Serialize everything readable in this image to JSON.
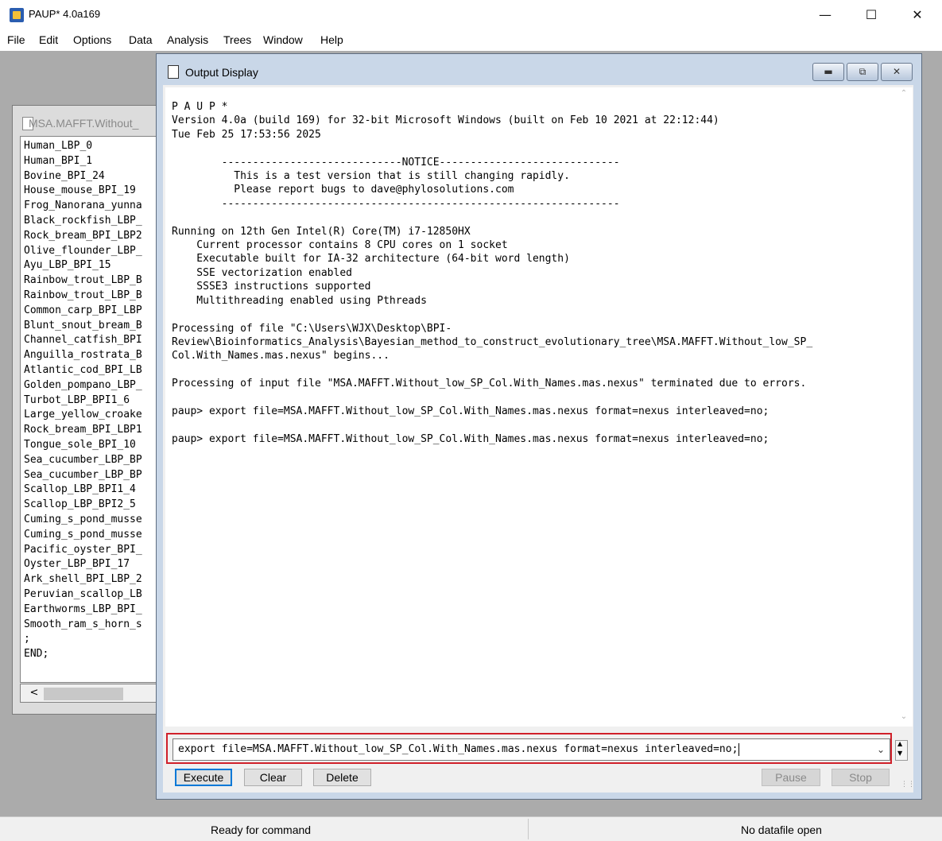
{
  "app": {
    "title": "PAUP* 4.0a169"
  },
  "menu": [
    "File",
    "Edit",
    "Options",
    "Data",
    "Analysis",
    "Trees",
    "Window",
    "Help"
  ],
  "doc_window": {
    "title": "MSA.MAFFT.Without_",
    "lines": [
      "Human_LBP_0",
      "Human_BPI_1",
      "Bovine_BPI_24",
      "House_mouse_BPI_19",
      "Frog_Nanorana_yunna",
      "Black_rockfish_LBP_",
      "Rock_bream_BPI_LBP2",
      "Olive_flounder_LBP_",
      "Ayu_LBP_BPI_15",
      "Rainbow_trout_LBP_B",
      "Rainbow_trout_LBP_B",
      "Common_carp_BPI_LBP",
      "Blunt_snout_bream_B",
      "Channel_catfish_BPI",
      "Anguilla_rostrata_B",
      "Atlantic_cod_BPI_LB",
      "Golden_pompano_LBP_",
      "Turbot_LBP_BPI1_6",
      "Large_yellow_croake",
      "Rock_bream_BPI_LBP1",
      "Tongue_sole_BPI_10",
      "Sea_cucumber_LBP_BP",
      "Sea_cucumber_LBP_BP",
      "Scallop_LBP_BPI1_4",
      "Scallop_LBP_BPI2_5",
      "Cuming_s_pond_musse",
      "Cuming_s_pond_musse",
      "Pacific_oyster_BPI_",
      "Oyster_LBP_BPI_17",
      "Ark_shell_BPI_LBP_2",
      "Peruvian_scallop_LB",
      "Earthworms_LBP_BPI_",
      "Smooth_ram_s_horn_s",
      ";",
      "END;"
    ],
    "hscroll_arrow": "<"
  },
  "output_window": {
    "title": "Output Display",
    "console": [
      "P A U P *",
      "Version 4.0a (build 169) for 32-bit Microsoft Windows (built on Feb 10 2021 at 22:12:44)",
      "Tue Feb 25 17:53:56 2025",
      "",
      "        -----------------------------NOTICE-----------------------------",
      "          This is a test version that is still changing rapidly.",
      "          Please report bugs to dave@phylosolutions.com",
      "        ----------------------------------------------------------------",
      "",
      "Running on 12th Gen Intel(R) Core(TM) i7-12850HX",
      "    Current processor contains 8 CPU cores on 1 socket",
      "    Executable built for IA-32 architecture (64-bit word length)",
      "    SSE vectorization enabled",
      "    SSSE3 instructions supported",
      "    Multithreading enabled using Pthreads",
      "",
      "Processing of file \"C:\\Users\\WJX\\Desktop\\BPI-",
      "Review\\Bioinformatics_Analysis\\Bayesian_method_to_construct_evolutionary_tree\\MSA.MAFFT.Without_low_SP_",
      "Col.With_Names.mas.nexus\" begins...",
      "",
      "Processing of input file \"MSA.MAFFT.Without_low_SP_Col.With_Names.mas.nexus\" terminated due to errors.",
      "",
      "paup> export file=MSA.MAFFT.Without_low_SP_Col.With_Names.mas.nexus format=nexus interleaved=no;",
      "",
      "paup> export file=MSA.MAFFT.Without_low_SP_Col.With_Names.mas.nexus format=nexus interleaved=no;"
    ],
    "command_value": "export file=MSA.MAFFT.Without_low_SP_Col.With_Names.mas.nexus format=nexus interleaved=no;",
    "buttons": {
      "execute": "Execute",
      "clear": "Clear",
      "delete": "Delete",
      "pause": "Pause",
      "stop": "Stop"
    }
  },
  "status": {
    "left": "Ready for command",
    "right": "No datafile open"
  },
  "colors": {
    "highlight_border": "#d0202a",
    "mdi_frame": "#c9d7e8"
  },
  "icons": [
    "app-icon",
    "minimize-icon",
    "maximize-icon",
    "close-icon",
    "document-icon",
    "dropdown-icon"
  ]
}
